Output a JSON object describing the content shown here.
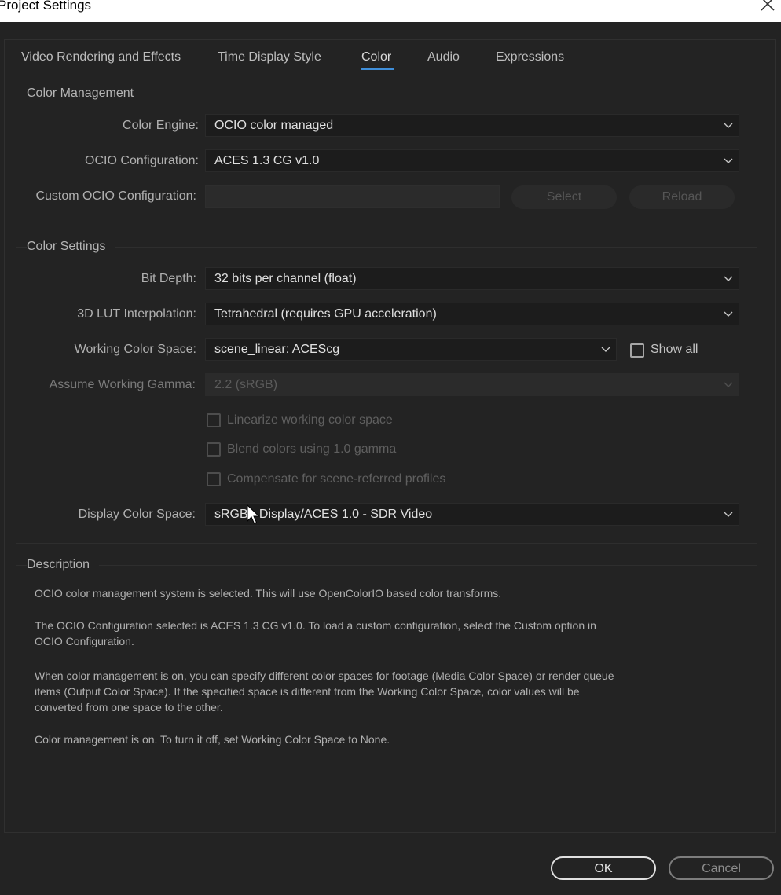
{
  "window": {
    "title": "Project Settings"
  },
  "tabs": [
    {
      "label": "Video Rendering and Effects",
      "active": false
    },
    {
      "label": "Time Display Style",
      "active": false
    },
    {
      "label": "Color",
      "active": true
    },
    {
      "label": "Audio",
      "active": false
    },
    {
      "label": "Expressions",
      "active": false
    }
  ],
  "color_management": {
    "legend": "Color Management",
    "color_engine": {
      "label": "Color Engine:",
      "value": "OCIO color managed"
    },
    "ocio_configuration": {
      "label": "OCIO Configuration:",
      "value": "ACES 1.3 CG v1.0"
    },
    "custom_ocio": {
      "label": "Custom OCIO Configuration:",
      "value": "",
      "select_label": "Select",
      "reload_label": "Reload"
    }
  },
  "color_settings": {
    "legend": "Color Settings",
    "bit_depth": {
      "label": "Bit Depth:",
      "value": "32 bits per channel (float)"
    },
    "lut_interpolation": {
      "label": "3D LUT Interpolation:",
      "value": "Tetrahedral (requires GPU acceleration)"
    },
    "working_color_space": {
      "label": "Working Color Space:",
      "value": "scene_linear: ACEScg",
      "show_all_label": "Show all",
      "show_all_checked": false
    },
    "assume_gamma": {
      "label": "Assume Working Gamma:",
      "value": "2.2 (sRGB)"
    },
    "linearize": {
      "label": "Linearize working color space",
      "checked": false
    },
    "blend_colors": {
      "label": "Blend colors using 1.0 gamma",
      "checked": false
    },
    "compensate": {
      "label": "Compensate for scene-referred profiles",
      "checked": false
    },
    "display_color_space": {
      "label": "Display Color Space:",
      "value": "sRGB - Display/ACES 1.0 - SDR Video"
    }
  },
  "description": {
    "legend": "Description",
    "paragraphs": [
      "OCIO color management system is selected. This will use OpenColorIO based color transforms.",
      "The OCIO Configuration selected is ACES 1.3 CG v1.0. To load a custom configuration, select the Custom option in OCIO Configuration.",
      "When color management is on, you can specify different color spaces for footage (Media Color Space) or render queue items (Output Color Space). If the specified space is different from the Working Color Space, color values will be converted from one space to the other.",
      "Color management is on. To turn it off, set Working Color Space to None."
    ]
  },
  "footer": {
    "ok_label": "OK",
    "cancel_label": "Cancel"
  },
  "colors": {
    "background": "#232323",
    "accent_tab": "#3f8ed9",
    "field": "#1c1c1c",
    "text": "#bdbdbd"
  },
  "icons": {
    "close": "close-icon",
    "dropdown": "chevron-down-icon",
    "cursor": "mouse-pointer-icon"
  }
}
